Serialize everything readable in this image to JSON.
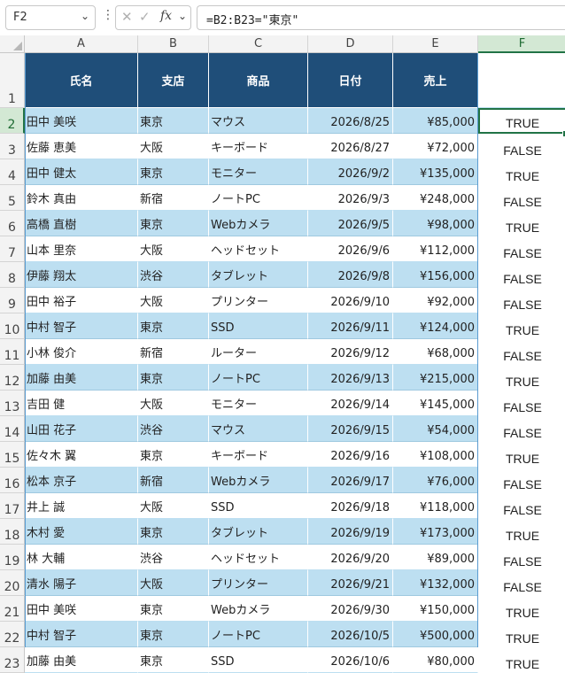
{
  "formula_bar": {
    "name_box": "F2",
    "fx_label": "fx",
    "formula": "=B2:B23=\"東京\""
  },
  "column_headers": [
    "A",
    "B",
    "C",
    "D",
    "E",
    "F"
  ],
  "selected_column": "F",
  "row_numbers": [
    "1",
    "2",
    "3",
    "4",
    "5",
    "6",
    "7",
    "8",
    "9",
    "10",
    "11",
    "12",
    "13",
    "14",
    "15",
    "16",
    "17",
    "18",
    "19",
    "20",
    "21",
    "22",
    "23"
  ],
  "table_headers": [
    "氏名",
    "支店",
    "商品",
    "日付",
    "売上"
  ],
  "rows": [
    {
      "name": "田中 美咲",
      "branch": "東京",
      "product": "マウス",
      "date": "2026/8/25",
      "sales": "¥85,000",
      "result": "TRUE"
    },
    {
      "name": "佐藤 恵美",
      "branch": "大阪",
      "product": "キーボード",
      "date": "2026/8/27",
      "sales": "¥72,000",
      "result": "FALSE"
    },
    {
      "name": "田中 健太",
      "branch": "東京",
      "product": "モニター",
      "date": "2026/9/2",
      "sales": "¥135,000",
      "result": "TRUE"
    },
    {
      "name": "鈴木 真由",
      "branch": "新宿",
      "product": "ノートPC",
      "date": "2026/9/3",
      "sales": "¥248,000",
      "result": "FALSE"
    },
    {
      "name": "高橋 直樹",
      "branch": "東京",
      "product": "Webカメラ",
      "date": "2026/9/5",
      "sales": "¥98,000",
      "result": "TRUE"
    },
    {
      "name": "山本 里奈",
      "branch": "大阪",
      "product": "ヘッドセット",
      "date": "2026/9/6",
      "sales": "¥112,000",
      "result": "FALSE"
    },
    {
      "name": "伊藤 翔太",
      "branch": "渋谷",
      "product": "タブレット",
      "date": "2026/9/8",
      "sales": "¥156,000",
      "result": "FALSE"
    },
    {
      "name": "田中 裕子",
      "branch": "大阪",
      "product": "プリンター",
      "date": "2026/9/10",
      "sales": "¥92,000",
      "result": "FALSE"
    },
    {
      "name": "中村 智子",
      "branch": "東京",
      "product": "SSD",
      "date": "2026/9/11",
      "sales": "¥124,000",
      "result": "TRUE"
    },
    {
      "name": "小林 俊介",
      "branch": "新宿",
      "product": "ルーター",
      "date": "2026/9/12",
      "sales": "¥68,000",
      "result": "FALSE"
    },
    {
      "name": "加藤 由美",
      "branch": "東京",
      "product": "ノートPC",
      "date": "2026/9/13",
      "sales": "¥215,000",
      "result": "TRUE"
    },
    {
      "name": "吉田 健",
      "branch": "大阪",
      "product": "モニター",
      "date": "2026/9/14",
      "sales": "¥145,000",
      "result": "FALSE"
    },
    {
      "name": "山田 花子",
      "branch": "渋谷",
      "product": "マウス",
      "date": "2026/9/15",
      "sales": "¥54,000",
      "result": "FALSE"
    },
    {
      "name": "佐々木 翼",
      "branch": "東京",
      "product": "キーボード",
      "date": "2026/9/16",
      "sales": "¥108,000",
      "result": "TRUE"
    },
    {
      "name": "松本 京子",
      "branch": "新宿",
      "product": "Webカメラ",
      "date": "2026/9/17",
      "sales": "¥76,000",
      "result": "FALSE"
    },
    {
      "name": "井上 誠",
      "branch": "大阪",
      "product": "SSD",
      "date": "2026/9/18",
      "sales": "¥118,000",
      "result": "FALSE"
    },
    {
      "name": "木村 愛",
      "branch": "東京",
      "product": "タブレット",
      "date": "2026/9/19",
      "sales": "¥173,000",
      "result": "TRUE"
    },
    {
      "name": "林 大輔",
      "branch": "渋谷",
      "product": "ヘッドセット",
      "date": "2026/9/20",
      "sales": "¥89,000",
      "result": "FALSE"
    },
    {
      "name": "清水 陽子",
      "branch": "大阪",
      "product": "プリンター",
      "date": "2026/9/21",
      "sales": "¥132,000",
      "result": "FALSE"
    },
    {
      "name": "田中 美咲",
      "branch": "東京",
      "product": "Webカメラ",
      "date": "2026/9/30",
      "sales": "¥150,000",
      "result": "TRUE"
    },
    {
      "name": "中村 智子",
      "branch": "東京",
      "product": "ノートPC",
      "date": "2026/10/5",
      "sales": "¥500,000",
      "result": "TRUE"
    },
    {
      "name": "加藤 由美",
      "branch": "東京",
      "product": "SSD",
      "date": "2026/10/6",
      "sales": "¥80,000",
      "result": "TRUE"
    }
  ],
  "colors": {
    "header_fill": "#1f4e79",
    "band_fill": "#bddff1",
    "selection_accent": "#217346"
  }
}
